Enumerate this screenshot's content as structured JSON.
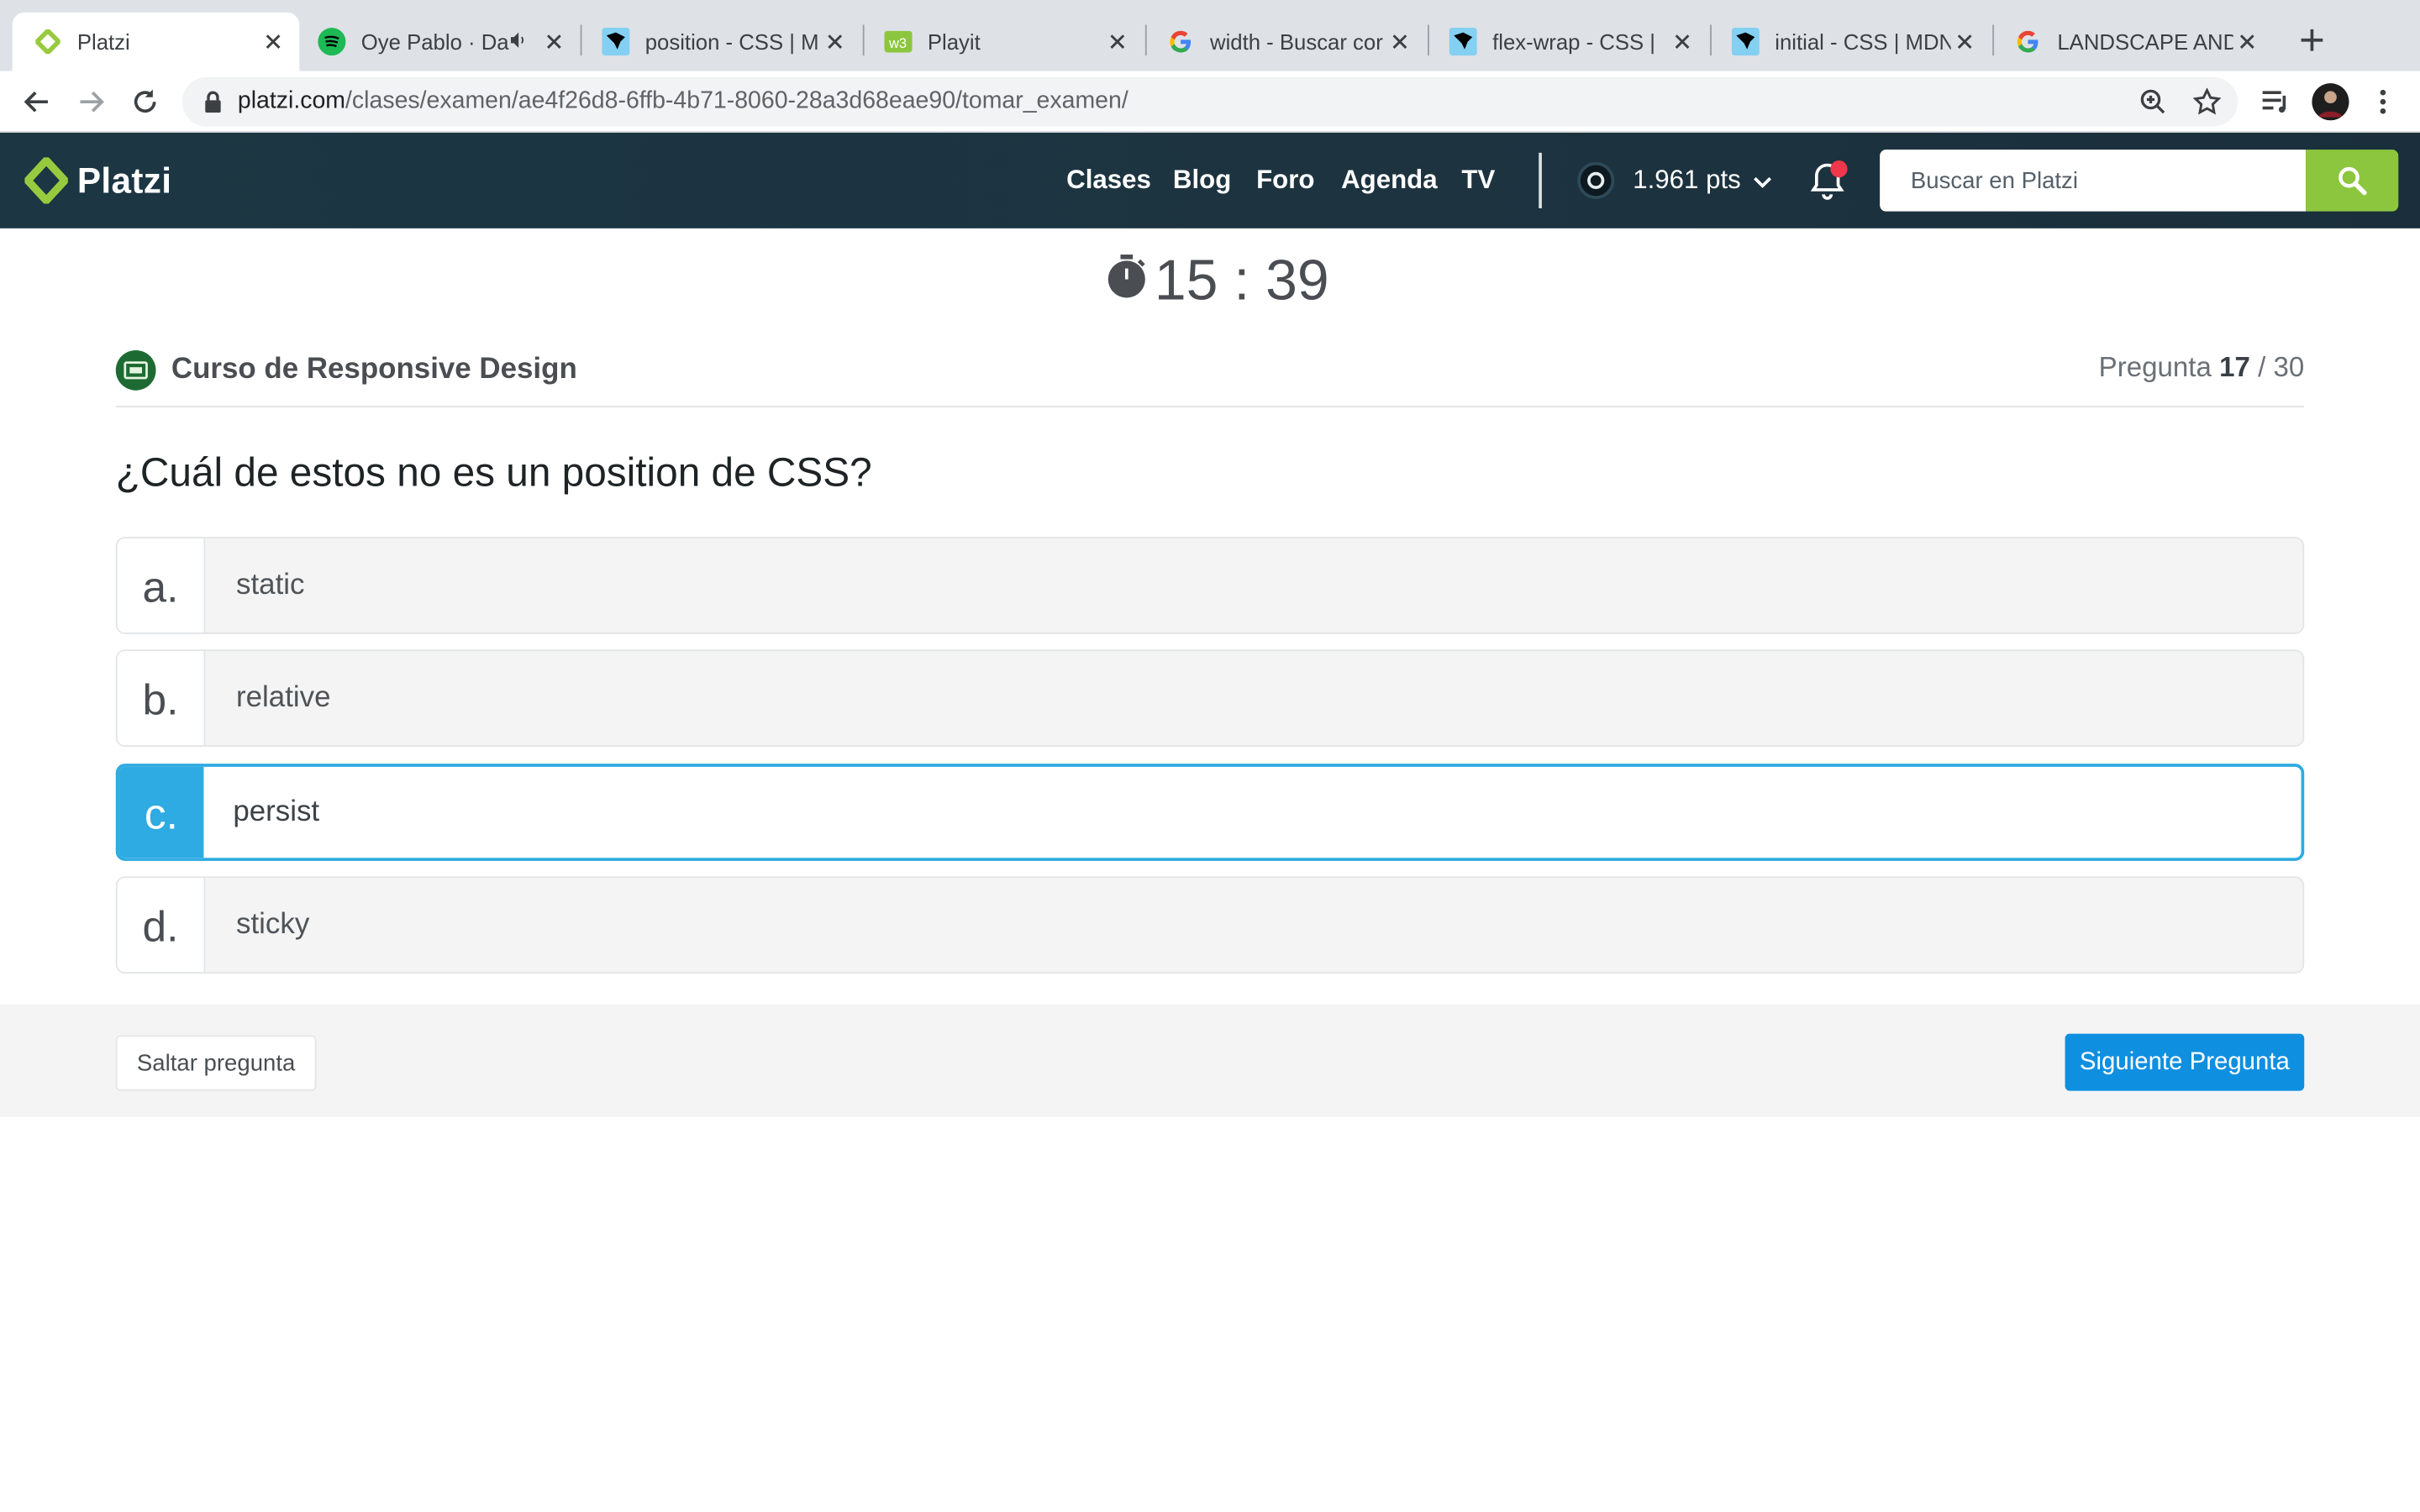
{
  "browser": {
    "tabs": [
      {
        "title": "Platzi",
        "favicon": "platzi-icon",
        "active": true
      },
      {
        "title": "Oye Pablo · Da",
        "favicon": "spotify-icon",
        "audio": true
      },
      {
        "title": "position - CSS | M",
        "favicon": "mdn-icon"
      },
      {
        "title": "Playit",
        "favicon": "playit-icon"
      },
      {
        "title": "width - Buscar cor",
        "favicon": "google-icon"
      },
      {
        "title": "flex-wrap - CSS | ",
        "favicon": "mdn-icon"
      },
      {
        "title": "initial - CSS | MDN",
        "favicon": "mdn-icon"
      },
      {
        "title": "LANDSCAPE AND",
        "favicon": "google-icon"
      }
    ],
    "url_host": "platzi.com",
    "url_path": "/clases/examen/ae4f26d8-6ffb-4b71-8060-28a3d68eae90/tomar_examen/"
  },
  "header": {
    "logo_text": "Platzi",
    "nav": [
      "Clases",
      "Blog",
      "Foro",
      "Agenda",
      "TV"
    ],
    "points": "1.961 pts",
    "search_placeholder": "Buscar en Platzi"
  },
  "exam": {
    "timer": "15 : 39",
    "course_name": "Curso de Responsive Design",
    "progress_prefix": "Pregunta",
    "current_question": "17",
    "total_questions": "/ 30",
    "question": "¿Cuál de estos no es un position de CSS?",
    "options": [
      {
        "letter": "a.",
        "text": "static",
        "selected": false
      },
      {
        "letter": "b.",
        "text": "relative",
        "selected": false
      },
      {
        "letter": "c.",
        "text": "persist",
        "selected": true
      },
      {
        "letter": "d.",
        "text": "sticky",
        "selected": false
      }
    ],
    "skip_label": "Saltar pregunta",
    "next_label": "Siguiente Pregunta"
  },
  "colors": {
    "brand_green": "#8cc63e",
    "selected_blue": "#2eabe2",
    "next_button": "#0f8fe0",
    "header_bg": "#1c3643"
  }
}
